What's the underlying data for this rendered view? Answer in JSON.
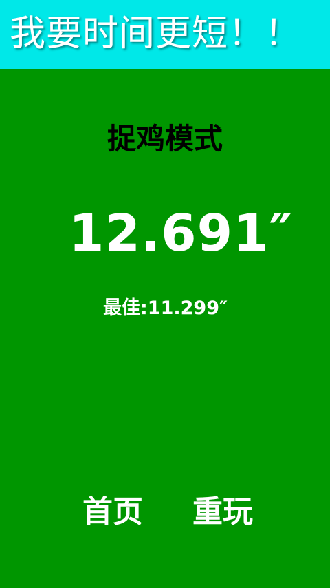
{
  "header": {
    "title": "我要时间更短！！",
    "background_color": "#00e8e8"
  },
  "page": {
    "background_color": "#009600"
  },
  "result": {
    "mode_title": "捉鸡模式",
    "time": "12.691″",
    "best": "最佳:11.299″"
  },
  "actions": {
    "home_label": "首页",
    "replay_label": "重玩"
  }
}
